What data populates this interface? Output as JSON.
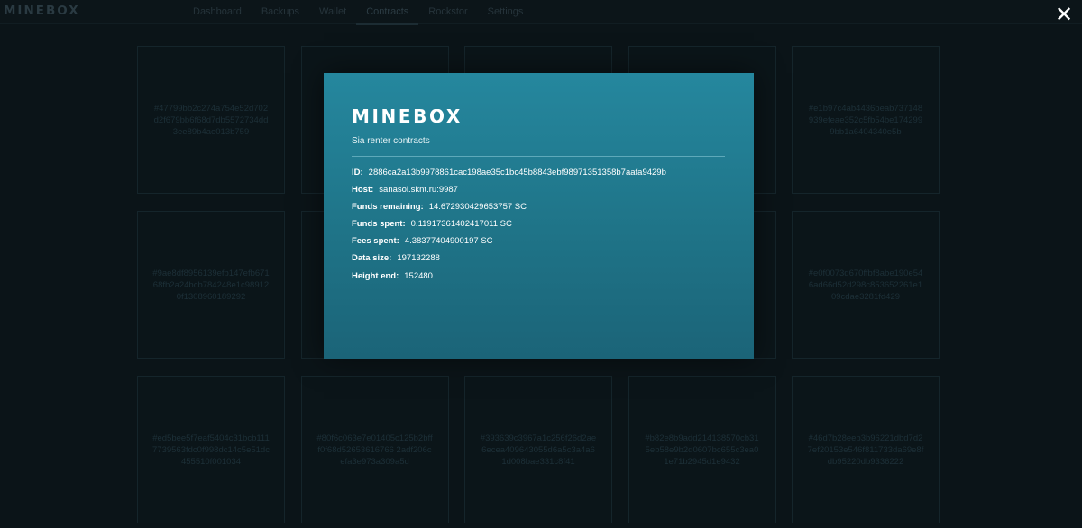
{
  "app": {
    "brand": "MINEBOX"
  },
  "nav": [
    {
      "label": "Dashboard",
      "name": "nav-dashboard",
      "active": false
    },
    {
      "label": "Backups",
      "name": "nav-backups",
      "active": false
    },
    {
      "label": "Wallet",
      "name": "nav-wallet",
      "active": false
    },
    {
      "label": "Contracts",
      "name": "nav-contracts",
      "active": true
    },
    {
      "label": "Rockstor",
      "name": "nav-rockstor",
      "active": false
    },
    {
      "label": "Settings",
      "name": "nav-settings",
      "active": false
    }
  ],
  "close": {
    "icon": "close-icon",
    "glyph": "✕"
  },
  "contracts": [
    "#47799bb2c274a754e52d702d2f679bb6f68d7db5572734dd3ee89b4ae013b759",
    "",
    "",
    "",
    "#e1b97c4ab4436beab737148939efeae352c5fb54be1742999bb1a6404340e5b",
    "#9ae8df8956139efb147efb67168fb2a24bcb784248e1c989120f1308960189292",
    "",
    "",
    "",
    "#e0f0073d670ffbf8abe190e546ad66d52d298c853652261e109cdae3281fd429",
    "#ed5bee5f7eaf5404c31bcb1117739563fdc0f998dc14c5e51dc455510f001034",
    "#80f6c063e7e01405c125b2bfff0f68d52653616766 2adf206cefa3e973a309a5d",
    "#393639c3967a1c256f26d2ae6ecea409643055d6a5c3a4a61d008bae331c8f41",
    "#b82e8b9add214138570cb315eb58e9b2d0607bc655c3ea01e71b2945d1e9432",
    "#46d7b28eeb3b96221dbd7d27ef20153e546f811733da69e8fdb95220db9336222"
  ],
  "modal": {
    "logo": "MINEBOX",
    "subtitle": "Sia renter contracts",
    "fields": [
      {
        "label": "ID:",
        "value": "2886ca2a13b9978861cac198ae35c1bc45b8843ebf98971351358b7aafa9429b"
      },
      {
        "label": "Host:",
        "value": "sanasol.sknt.ru:9987"
      },
      {
        "label": "Funds remaining:",
        "value": "14.672930429653757 SC"
      },
      {
        "label": "Funds spent:",
        "value": "0.11917361402417011 SC"
      },
      {
        "label": "Fees spent:",
        "value": "4.38377404900197 SC"
      },
      {
        "label": "Data size:",
        "value": "197132288"
      },
      {
        "label": "Height end:",
        "value": "152480"
      }
    ]
  },
  "colors": {
    "background": "#0b1418",
    "modal_top": "#25879e",
    "modal_bottom": "#1b6478",
    "text_white": "#ffffff"
  }
}
